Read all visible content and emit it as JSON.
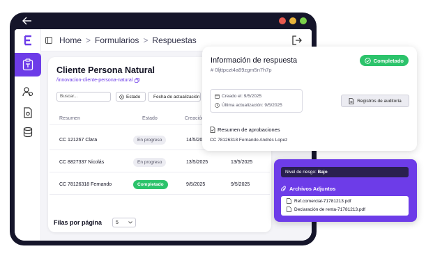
{
  "breadcrumb": {
    "home": "Home",
    "forms": "Formularios",
    "responses": "Respuestas",
    "separator": ">"
  },
  "colors": {
    "accent": "#6d3ce8",
    "success": "#2cc36b",
    "device": "#15152a",
    "window_dots": [
      "#e85a4f",
      "#e8b33b",
      "#7bd14a"
    ]
  },
  "sidebar": {
    "icons": [
      "brand-logo-icon",
      "form-icon",
      "users-icon",
      "document-settings-icon",
      "database-icon"
    ]
  },
  "card": {
    "title": "Cliente Persona Natural",
    "slug": "/innovacion-cliente-persona-natural",
    "search_placeholder": "Buscar...",
    "filters": [
      "Estado",
      "Fecha de actualización"
    ],
    "columns": [
      "Resumen",
      "Estado",
      "Creación",
      "Fecha",
      "Acciones"
    ],
    "rows": [
      {
        "summary": "CC 121267 Clara",
        "status": "En progreso",
        "created": "14/5/2025",
        "updated": ""
      },
      {
        "summary": "CC 8827337 Nicolás",
        "status": "En progreso",
        "created": "13/5/2025",
        "updated": "13/5/2025"
      },
      {
        "summary": "CC 78126318 Fernando",
        "status": "Completado",
        "created": "9/5/2025",
        "updated": "9/5/2025"
      }
    ],
    "rows_per_page_label": "Filas por página",
    "rows_per_page_value": "5"
  },
  "response_panel": {
    "title": "Información de respuesta",
    "id": "# 0ljttpczt4a89zgm5n7h7p",
    "status": "Completado",
    "created_label": "Creado el: 9/5/2025",
    "updated_label": "Última actualización: 9/5/2025",
    "audit_button": "Registros de auditoría",
    "approvals_title": "Resumen de aprobaciones",
    "approvals_value": "CC 78126318 Fernando Andrés Lopez"
  },
  "attachments_panel": {
    "risk_label": "Nivel de riesgo:",
    "risk_value": "Bajo",
    "title": "Archivos Adjuntos",
    "files": [
      "Ref.comercial-71781213.pdf",
      "Declaración de renta-71781213.pdf"
    ]
  }
}
